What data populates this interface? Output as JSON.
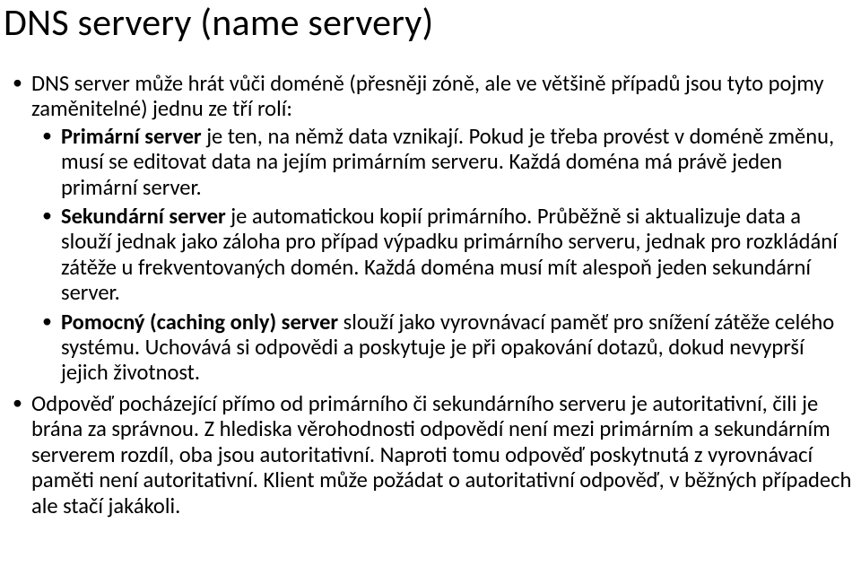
{
  "title": "DNS servery (name servery)",
  "bullets": {
    "intro": "DNS server může hrát vůči doméně (přesněji zóně, ale ve většině případů jsou tyto pojmy zaměnitelné) jednu ze tří rolí:",
    "primary": {
      "label": "Primární server",
      "rest": " je ten, na němž data vznikají. Pokud je třeba provést v doméně změnu, musí se editovat data na jejím primárním serveru. Každá doména má právě jeden primární server."
    },
    "secondary": {
      "label": "Sekundární server",
      "rest": " je automatickou kopií primárního. Průběžně si aktualizuje data a slouží jednak jako záloha pro případ výpadku primárního serveru, jednak pro rozkládání zátěže u frekventovaných domén. Každá doména musí mít alespoň jeden sekundární server."
    },
    "caching": {
      "label": "Pomocný (caching only) server",
      "rest": " slouží jako vyrovnávací paměť pro snížení zátěže celého systému. Uchovává si odpovědi a poskytuje je při opakování dotazů, dokud nevyprší jejich životnost."
    },
    "answer": "Odpověď pocházející přímo od primárního či sekundárního serveru je autoritativní, čili je brána za správnou. Z hlediska věrohodnosti odpovědí není mezi primárním a sekundárním serverem rozdíl, oba jsou autoritativní. Naproti tomu odpověď poskytnutá z vyrovnávací paměti není autoritativní. Klient může požádat o autoritativní odpověď, v běžných případech ale stačí jakákoli."
  }
}
